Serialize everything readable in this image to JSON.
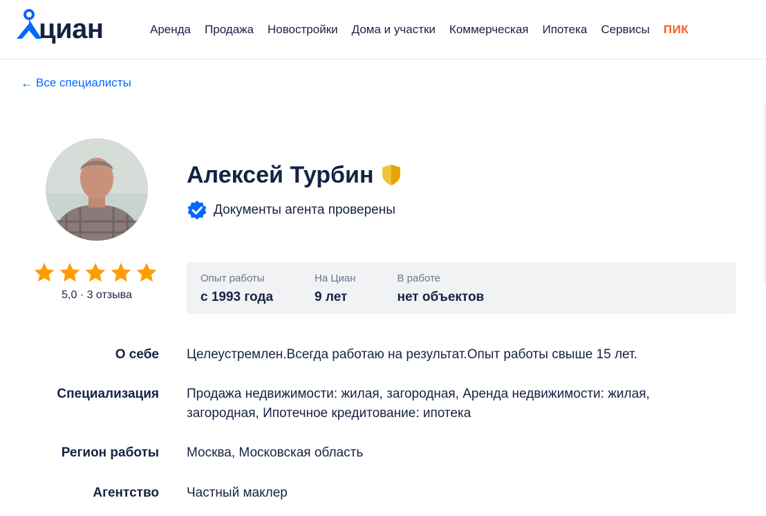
{
  "header": {
    "logo_text": "циан",
    "nav": [
      "Аренда",
      "Продажа",
      "Новостройки",
      "Дома и участки",
      "Коммерческая",
      "Ипотека",
      "Сервисы"
    ],
    "nav_brand": "ПИК"
  },
  "back_link": {
    "arrow": "←",
    "label": "Все специалисты"
  },
  "profile": {
    "name": "Алексей Турбин",
    "verified_text": "Документы агента проверены",
    "rating": {
      "stars": 5,
      "text": "5,0 · 3 отзыва"
    }
  },
  "stats": [
    {
      "label": "Опыт работы",
      "value": "с 1993 года"
    },
    {
      "label": "На Циан",
      "value": "9 лет"
    },
    {
      "label": "В работе",
      "value": "нет объектов"
    }
  ],
  "info": [
    {
      "label": "О себе",
      "value": "Целеустремлен.Всегда работаю на результат.Опыт работы свыше 15 лет."
    },
    {
      "label": "Специализация",
      "value": "Продажа недвижимости: жилая, загородная, Аренда недвижимости: жилая, загородная, Ипотечное кредитование: ипотека"
    },
    {
      "label": "Регион работы",
      "value": "Москва, Московская область"
    },
    {
      "label": "Агентство",
      "value": "Частный маклер"
    }
  ],
  "colors": {
    "brand": "#0468ff",
    "text": "#152242",
    "pik": "#ff5a1f",
    "star": "#ff9d00",
    "stats_bg": "#f1f2f4"
  },
  "icons": [
    "location-pin-icon",
    "arrow-left-icon",
    "shield-badge-icon",
    "verified-check-icon",
    "star-icon"
  ]
}
